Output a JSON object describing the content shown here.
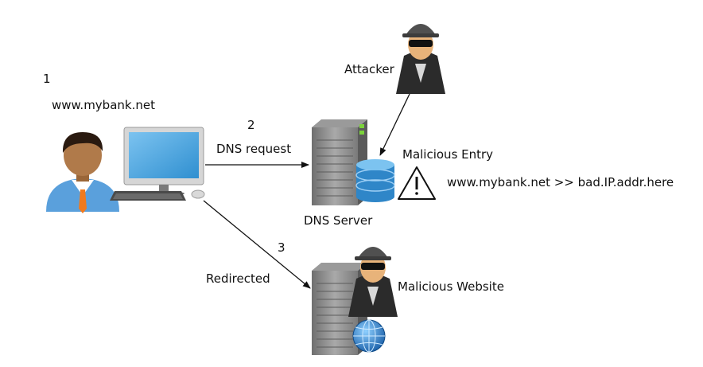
{
  "steps": {
    "step1": "1",
    "step2": "2",
    "step3": "3"
  },
  "labels": {
    "url": "www.mybank.net",
    "dns_request": "DNS request",
    "attacker": "Attacker",
    "malicious_entry": "Malicious Entry",
    "mapping": "www.mybank.net >> bad.IP.addr.here",
    "dns_server": "DNS Server",
    "redirected": "Redirected",
    "malicious_website": "Malicious Website"
  },
  "icons": {
    "user": "user-icon",
    "computer": "desktop-computer-icon",
    "dns_server": "server-icon",
    "database": "database-icon",
    "warning": "warning-icon",
    "attacker": "hacker-icon",
    "web_server": "server-icon",
    "globe": "globe-icon"
  },
  "colors": {
    "screen": "#4aa3de",
    "server": "#8a8a8a",
    "database": "#2f86c8",
    "shirt": "#5aa0dc",
    "tie": "#f07a1e",
    "skin": "#b07a4a",
    "hacker_coat": "#2b2b2b"
  }
}
